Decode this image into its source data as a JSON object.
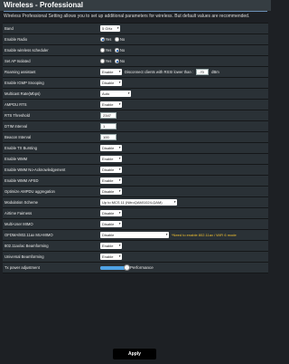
{
  "header": {
    "title": "Wireless - Professional",
    "description": "Wireless Professional Setting allows you to set up additional parameters for wireless. But default values are recommended."
  },
  "settings": [
    {
      "label": "Band",
      "type": "select",
      "value": "5 GHz"
    },
    {
      "label": "Enable Radio",
      "type": "radio",
      "options": [
        "Yes",
        "No"
      ],
      "selected": "Yes"
    },
    {
      "label": "Enable wireless scheduler",
      "type": "radio",
      "options": [
        "Yes",
        "No"
      ],
      "selected": "No"
    },
    {
      "label": "Set AP Isolated",
      "type": "radio",
      "options": [
        "Yes",
        "No"
      ],
      "selected": "No"
    },
    {
      "label": "Roaming assistant",
      "type": "roaming",
      "value": "Enable",
      "text": "Disconnect clients with RSSI lower than :",
      "rssi": "-70",
      "unit": "dBm"
    },
    {
      "label": "Enable IGMP Snooping",
      "type": "select",
      "value": "Disable"
    },
    {
      "label": "Multicast Rate(Mbps)",
      "type": "select",
      "value": "Auto"
    },
    {
      "label": "AMPDU RTS",
      "type": "select",
      "value": "Enable"
    },
    {
      "label": "RTS Threshold",
      "type": "text",
      "value": "2347"
    },
    {
      "label": "DTIM Interval",
      "type": "text",
      "value": "1"
    },
    {
      "label": "Beacon Interval",
      "type": "text",
      "value": "100"
    },
    {
      "label": "Enable TX Bursting",
      "type": "select",
      "value": "Disable"
    },
    {
      "label": "Enable WMM",
      "type": "select",
      "value": "Enable"
    },
    {
      "label": "Enable WMM No-Acknowledgement",
      "type": "select",
      "value": "Disable"
    },
    {
      "label": "Enable WMM APSD",
      "type": "select",
      "value": "Enable"
    },
    {
      "label": "Optimize AMPDU aggregation",
      "type": "select",
      "value": "Disable"
    },
    {
      "label": "Modulation Scheme",
      "type": "select",
      "value": "Up to MCS 11 (NitroQAM/1024-QAM)"
    },
    {
      "label": "Airtime Fairness",
      "type": "select",
      "value": "Disable"
    },
    {
      "label": "Multi-User MIMO",
      "type": "select",
      "value": "Disable"
    },
    {
      "label": "OFDMA/802.11ax MU-MIMO",
      "type": "ofdma",
      "value": "Disable",
      "note": "*Need to enable 802.11ax / WiFi 6 mode"
    },
    {
      "label": "802.11ax/ac Beamforming",
      "type": "select",
      "value": "Enable"
    },
    {
      "label": "Universal Beamforming",
      "type": "select",
      "value": "Enable"
    },
    {
      "label": "Tx power adjustment",
      "type": "slider",
      "level": 1.0,
      "text": "Performance"
    }
  ],
  "apply_label": "Apply",
  "colors": {
    "accent": "#4fa3e6",
    "background": "#2a3136",
    "note": "#f0c030"
  }
}
